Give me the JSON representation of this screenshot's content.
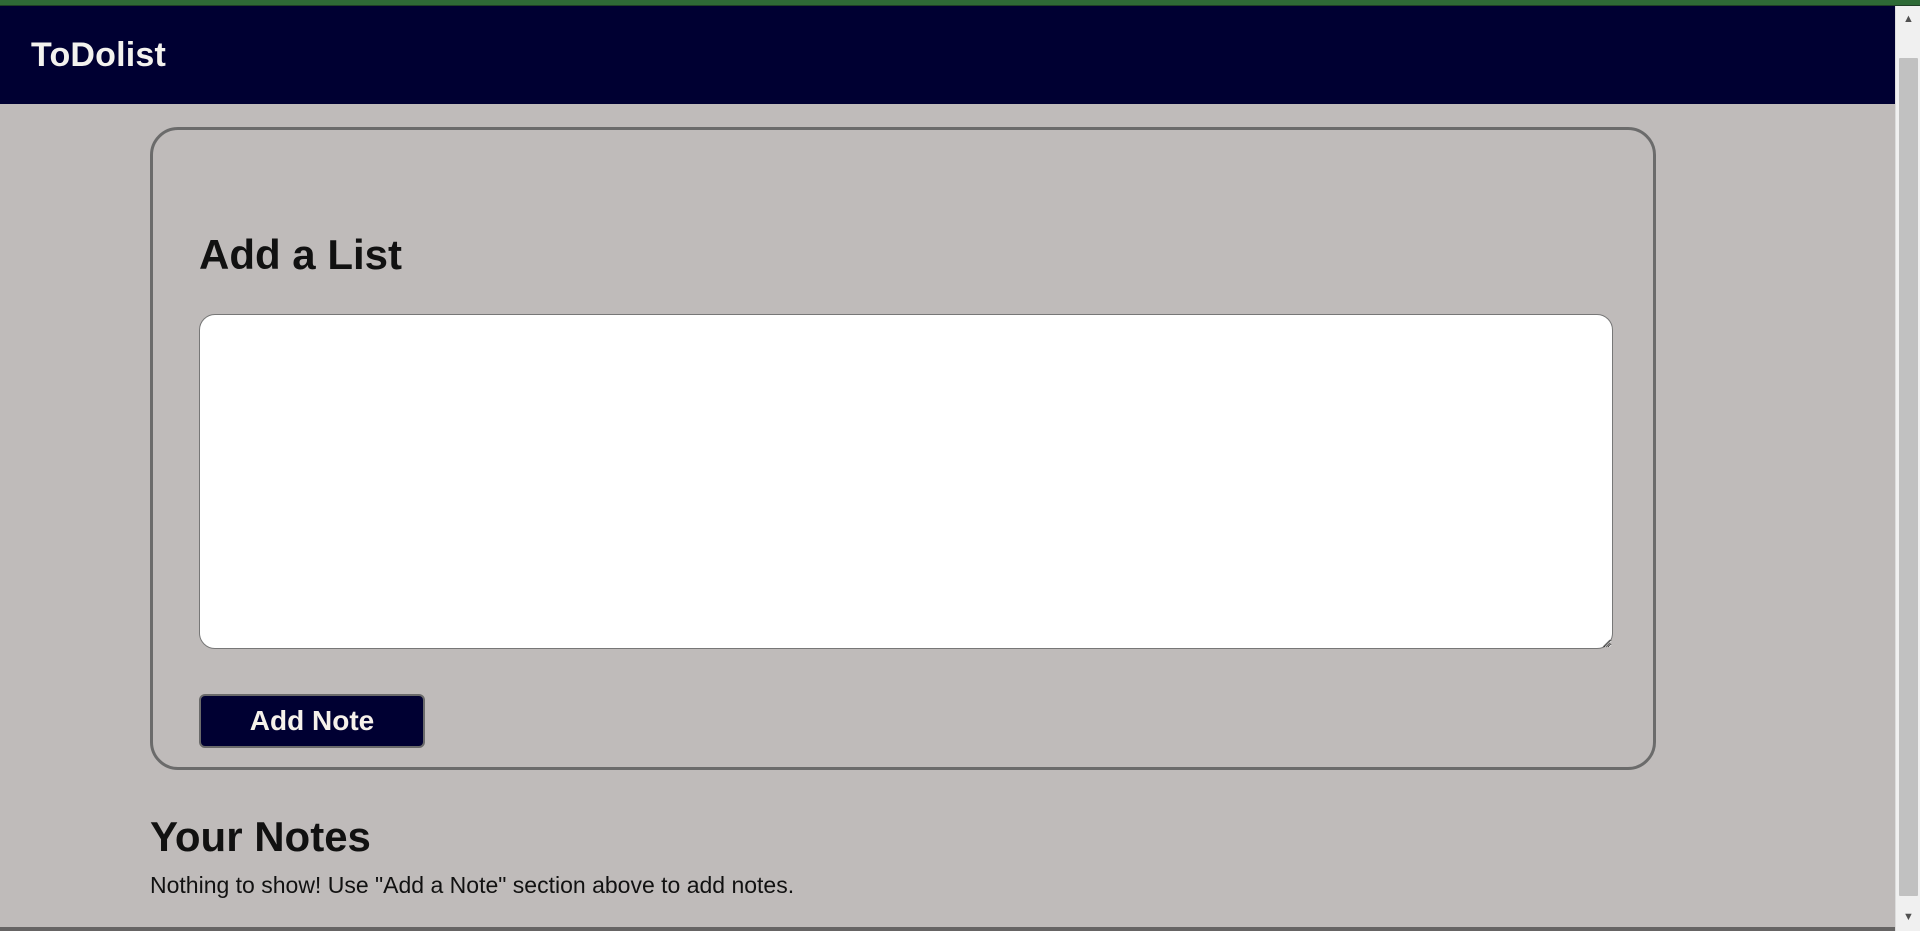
{
  "app": {
    "brand": "ToDolist"
  },
  "add_list": {
    "title": "Add a List",
    "textarea_value": "",
    "button_label": "Add Note"
  },
  "notes": {
    "heading": "Your Notes",
    "empty_message": "Nothing to show! Use \"Add a Note\" section above to add notes."
  },
  "icons": {
    "scroll_up": "chevron-up-icon",
    "scroll_down": "chevron-down-icon",
    "resize": "resize-handle-icon"
  },
  "colors": {
    "navbar": "#000032",
    "background": "#bfbbba",
    "brand_text": "#f3f2ee",
    "button_text": "#f6f1ea",
    "top_border": "#2e6a36"
  }
}
